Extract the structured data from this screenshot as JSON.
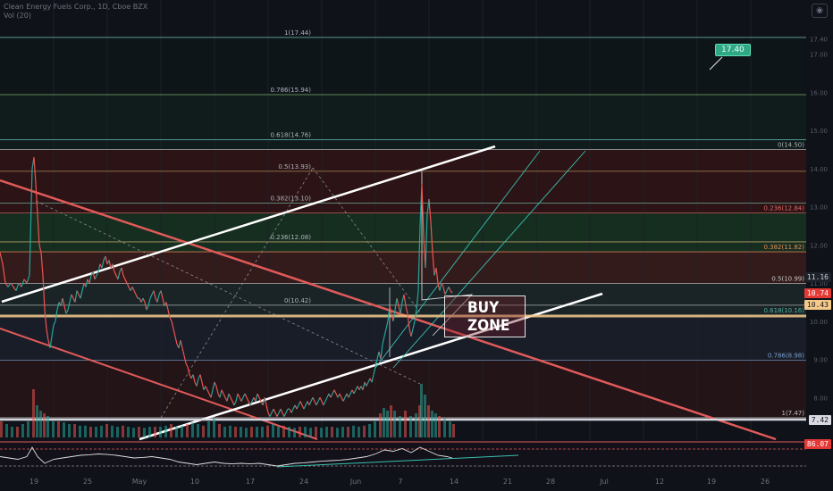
{
  "header": {
    "line1": "Clean Energy Fuels Corp., 1D, Cboe BZX",
    "line2": "Vol (20)"
  },
  "camera_icon": "camera-icon",
  "chart_data": {
    "type": "line",
    "title": "",
    "x_ticks": [
      "19",
      "25",
      "May",
      "10",
      "17",
      "24",
      "Jun",
      "7",
      "14",
      "21",
      "28",
      "Jul",
      "12",
      "19",
      "26"
    ],
    "y_ticks": [
      "17.40",
      "17.00",
      "16.00",
      "15.00",
      "14.00",
      "13.00",
      "12.00",
      "11.00",
      "10.00",
      "9.00",
      "8.00"
    ],
    "ylim": [
      7.0,
      18.0
    ],
    "price_labels": [
      {
        "text": "11.16",
        "value": 11.16,
        "color": "#c8ccd4",
        "bg": "#1e222b"
      },
      {
        "text": "10.74",
        "value": 10.74,
        "color": "#ffffff",
        "bg": "#e53935"
      },
      {
        "text": "10.43",
        "value": 10.43,
        "color": "#0f1218",
        "bg": "#f5c98a"
      },
      {
        "text": "7.42",
        "value": 7.42,
        "color": "#0f1218",
        "bg": "#d8d8e0"
      },
      {
        "text": "86.07",
        "value": 86.07,
        "color": "#ffffff",
        "bg": "#e53935"
      }
    ],
    "target_label": "17.40",
    "fib_left": [
      {
        "text": "1(17.44)",
        "value": 17.44
      },
      {
        "text": "0.786(15.94)",
        "value": 15.94
      },
      {
        "text": "0.618(14.76)",
        "value": 14.76
      },
      {
        "text": "0.5(13.93)",
        "value": 13.93
      },
      {
        "text": "0.382(13.10)",
        "value": 13.1
      },
      {
        "text": "0.236(12.08)",
        "value": 12.08
      },
      {
        "text": "0(10.42)",
        "value": 10.42
      }
    ],
    "fib_right": [
      {
        "text": "0(14.50)",
        "value": 14.5
      },
      {
        "text": "0.236(12.84)",
        "value": 12.84
      },
      {
        "text": "0.382(11.82)",
        "value": 11.82
      },
      {
        "text": "0.5(10.99)",
        "value": 10.99
      },
      {
        "text": "0.618(10.16)",
        "value": 10.16
      },
      {
        "text": "0.786(8.98)",
        "value": 8.98
      },
      {
        "text": "1(7.47)",
        "value": 7.47
      }
    ],
    "price_series": [
      [
        0,
        11.8
      ],
      [
        3,
        11.5
      ],
      [
        6,
        11.0
      ],
      [
        9,
        10.9
      ],
      [
        12,
        11.0
      ],
      [
        15,
        10.9
      ],
      [
        18,
        10.8
      ],
      [
        21,
        11.0
      ],
      [
        24,
        10.9
      ],
      [
        27,
        11.1
      ],
      [
        30,
        11.0
      ],
      [
        33,
        11.2
      ],
      [
        36,
        14.0
      ],
      [
        38,
        14.3
      ],
      [
        40,
        13.6
      ],
      [
        42,
        12.8
      ],
      [
        44,
        12.0
      ],
      [
        46,
        11.8
      ],
      [
        48,
        11.2
      ],
      [
        50,
        10.3
      ],
      [
        52,
        9.8
      ],
      [
        54,
        9.5
      ],
      [
        56,
        9.3
      ],
      [
        58,
        9.6
      ],
      [
        60,
        9.9
      ],
      [
        62,
        10.0
      ],
      [
        64,
        10.3
      ],
      [
        66,
        10.5
      ],
      [
        68,
        10.4
      ],
      [
        70,
        10.6
      ],
      [
        72,
        10.4
      ],
      [
        74,
        10.2
      ],
      [
        76,
        10.3
      ],
      [
        78,
        10.5
      ],
      [
        80,
        10.7
      ],
      [
        82,
        10.6
      ],
      [
        84,
        10.5
      ],
      [
        86,
        10.8
      ],
      [
        88,
        10.7
      ],
      [
        90,
        10.6
      ],
      [
        92,
        10.8
      ],
      [
        94,
        11.0
      ],
      [
        96,
        10.9
      ],
      [
        98,
        11.1
      ],
      [
        100,
        11.0
      ],
      [
        102,
        11.2
      ],
      [
        104,
        11.3
      ],
      [
        106,
        11.1
      ],
      [
        108,
        11.2
      ],
      [
        110,
        11.3
      ],
      [
        112,
        11.5
      ],
      [
        114,
        11.4
      ],
      [
        116,
        11.6
      ],
      [
        118,
        11.7
      ],
      [
        120,
        11.5
      ],
      [
        122,
        11.6
      ],
      [
        124,
        11.4
      ],
      [
        126,
        11.5
      ],
      [
        128,
        11.3
      ],
      [
        130,
        11.2
      ],
      [
        132,
        11.1
      ],
      [
        134,
        11.3
      ],
      [
        136,
        11.4
      ],
      [
        138,
        11.2
      ],
      [
        140,
        11.1
      ],
      [
        142,
        11.0
      ],
      [
        144,
        10.9
      ],
      [
        146,
        10.8
      ],
      [
        148,
        10.9
      ],
      [
        150,
        10.8
      ],
      [
        152,
        10.7
      ],
      [
        154,
        10.6
      ],
      [
        156,
        10.6
      ],
      [
        158,
        10.5
      ],
      [
        160,
        10.6
      ],
      [
        162,
        10.5
      ],
      [
        164,
        10.3
      ],
      [
        166,
        10.4
      ],
      [
        168,
        10.6
      ],
      [
        170,
        10.7
      ],
      [
        172,
        10.8
      ],
      [
        174,
        10.6
      ],
      [
        176,
        10.5
      ],
      [
        178,
        10.7
      ],
      [
        180,
        10.8
      ],
      [
        182,
        10.6
      ],
      [
        184,
        10.4
      ],
      [
        186,
        10.5
      ],
      [
        188,
        10.3
      ],
      [
        190,
        10.1
      ],
      [
        192,
        10.0
      ],
      [
        194,
        9.8
      ],
      [
        196,
        9.6
      ],
      [
        198,
        9.4
      ],
      [
        200,
        9.3
      ],
      [
        202,
        9.5
      ],
      [
        204,
        9.3
      ],
      [
        206,
        9.1
      ],
      [
        208,
        8.9
      ],
      [
        210,
        8.8
      ],
      [
        212,
        8.6
      ],
      [
        214,
        8.5
      ],
      [
        216,
        8.6
      ],
      [
        218,
        8.4
      ],
      [
        220,
        8.3
      ],
      [
        222,
        8.5
      ],
      [
        224,
        8.6
      ],
      [
        226,
        8.4
      ],
      [
        228,
        8.2
      ],
      [
        230,
        8.3
      ],
      [
        232,
        8.2
      ],
      [
        234,
        8.1
      ],
      [
        236,
        8.0
      ],
      [
        238,
        8.2
      ],
      [
        240,
        8.4
      ],
      [
        242,
        8.3
      ],
      [
        244,
        8.1
      ],
      [
        246,
        8.0
      ],
      [
        248,
        8.2
      ],
      [
        250,
        8.1
      ],
      [
        252,
        8.0
      ],
      [
        254,
        7.9
      ],
      [
        256,
        8.1
      ],
      [
        258,
        8.0
      ],
      [
        260,
        7.9
      ],
      [
        262,
        7.8
      ],
      [
        264,
        7.9
      ],
      [
        266,
        8.1
      ],
      [
        268,
        8.0
      ],
      [
        270,
        7.9
      ],
      [
        272,
        8.0
      ],
      [
        274,
        8.1
      ],
      [
        276,
        8.0
      ],
      [
        278,
        7.9
      ],
      [
        280,
        7.8
      ],
      [
        282,
        7.9
      ],
      [
        284,
        8.0
      ],
      [
        286,
        7.9
      ],
      [
        288,
        8.1
      ],
      [
        290,
        8.0
      ],
      [
        292,
        7.9
      ],
      [
        294,
        7.8
      ],
      [
        296,
        8.0
      ],
      [
        298,
        7.8
      ],
      [
        300,
        7.6
      ],
      [
        302,
        7.5
      ],
      [
        304,
        7.6
      ],
      [
        306,
        7.7
      ],
      [
        308,
        7.6
      ],
      [
        310,
        7.5
      ],
      [
        312,
        7.6
      ],
      [
        314,
        7.7
      ],
      [
        316,
        7.6
      ],
      [
        318,
        7.5
      ],
      [
        320,
        7.6
      ],
      [
        322,
        7.7
      ],
      [
        324,
        7.7
      ],
      [
        326,
        7.6
      ],
      [
        328,
        7.7
      ],
      [
        330,
        7.8
      ],
      [
        332,
        7.7
      ],
      [
        334,
        7.8
      ],
      [
        336,
        7.9
      ],
      [
        338,
        7.8
      ],
      [
        340,
        7.7
      ],
      [
        342,
        7.8
      ],
      [
        344,
        7.9
      ],
      [
        346,
        7.8
      ],
      [
        348,
        7.9
      ],
      [
        350,
        8.0
      ],
      [
        352,
        7.9
      ],
      [
        354,
        7.8
      ],
      [
        356,
        7.9
      ],
      [
        358,
        8.0
      ],
      [
        360,
        7.9
      ],
      [
        362,
        7.8
      ],
      [
        364,
        7.9
      ],
      [
        366,
        8.0
      ],
      [
        368,
        8.1
      ],
      [
        370,
        8.0
      ],
      [
        372,
        8.1
      ],
      [
        374,
        8.2
      ],
      [
        376,
        8.1
      ],
      [
        378,
        8.0
      ],
      [
        380,
        8.1
      ],
      [
        382,
        8.0
      ],
      [
        384,
        7.9
      ],
      [
        386,
        8.0
      ],
      [
        388,
        8.1
      ],
      [
        390,
        8.0
      ],
      [
        392,
        8.1
      ],
      [
        394,
        8.2
      ],
      [
        396,
        8.1
      ],
      [
        398,
        8.2
      ],
      [
        400,
        8.3
      ],
      [
        402,
        8.2
      ],
      [
        404,
        8.3
      ],
      [
        406,
        8.2
      ],
      [
        408,
        8.4
      ],
      [
        410,
        8.3
      ],
      [
        412,
        8.4
      ],
      [
        414,
        8.5
      ],
      [
        416,
        8.4
      ],
      [
        418,
        8.6
      ],
      [
        420,
        8.8
      ],
      [
        422,
        9.0
      ],
      [
        424,
        9.2
      ],
      [
        426,
        9.0
      ],
      [
        428,
        9.4
      ],
      [
        430,
        9.6
      ],
      [
        432,
        9.8
      ],
      [
        434,
        10.0
      ],
      [
        436,
        10.4
      ],
      [
        438,
        10.2
      ],
      [
        440,
        10.0
      ],
      [
        442,
        10.3
      ],
      [
        444,
        10.6
      ],
      [
        446,
        10.4
      ],
      [
        448,
        10.2
      ],
      [
        450,
        10.5
      ],
      [
        452,
        10.7
      ],
      [
        454,
        10.4
      ],
      [
        456,
        10.2
      ],
      [
        458,
        9.8
      ],
      [
        460,
        9.6
      ],
      [
        462,
        9.8
      ],
      [
        464,
        10.0
      ],
      [
        466,
        10.3
      ],
      [
        468,
        10.8
      ],
      [
        470,
        12.5
      ],
      [
        472,
        13.6
      ],
      [
        474,
        12.2
      ],
      [
        476,
        11.4
      ],
      [
        478,
        12.8
      ],
      [
        480,
        13.2
      ],
      [
        482,
        12.6
      ],
      [
        484,
        11.8
      ],
      [
        486,
        11.2
      ],
      [
        488,
        11.4
      ],
      [
        490,
        11.0
      ],
      [
        492,
        10.8
      ],
      [
        494,
        11.0
      ],
      [
        496,
        10.9
      ],
      [
        498,
        10.7
      ],
      [
        500,
        10.8
      ],
      [
        502,
        10.9
      ],
      [
        504,
        10.8
      ],
      [
        506,
        10.74
      ]
    ],
    "volume_series": [
      [
        0,
        0.3
      ],
      [
        6,
        0.25
      ],
      [
        12,
        0.2
      ],
      [
        18,
        0.2
      ],
      [
        24,
        0.25
      ],
      [
        30,
        0.3
      ],
      [
        36,
        0.9
      ],
      [
        40,
        0.6
      ],
      [
        44,
        0.5
      ],
      [
        48,
        0.45
      ],
      [
        52,
        0.4
      ],
      [
        58,
        0.3
      ],
      [
        64,
        0.3
      ],
      [
        70,
        0.28
      ],
      [
        76,
        0.25
      ],
      [
        82,
        0.25
      ],
      [
        88,
        0.22
      ],
      [
        94,
        0.22
      ],
      [
        100,
        0.2
      ],
      [
        106,
        0.2
      ],
      [
        112,
        0.22
      ],
      [
        118,
        0.25
      ],
      [
        124,
        0.22
      ],
      [
        130,
        0.2
      ],
      [
        136,
        0.22
      ],
      [
        142,
        0.2
      ],
      [
        148,
        0.18
      ],
      [
        154,
        0.2
      ],
      [
        160,
        0.18
      ],
      [
        166,
        0.2
      ],
      [
        172,
        0.2
      ],
      [
        178,
        0.2
      ],
      [
        184,
        0.22
      ],
      [
        190,
        0.25
      ],
      [
        196,
        0.2
      ],
      [
        202,
        0.22
      ],
      [
        208,
        0.25
      ],
      [
        214,
        0.28
      ],
      [
        220,
        0.25
      ],
      [
        226,
        0.22
      ],
      [
        232,
        0.3
      ],
      [
        238,
        0.35
      ],
      [
        244,
        0.25
      ],
      [
        250,
        0.2
      ],
      [
        256,
        0.22
      ],
      [
        262,
        0.2
      ],
      [
        268,
        0.2
      ],
      [
        274,
        0.18
      ],
      [
        280,
        0.2
      ],
      [
        286,
        0.2
      ],
      [
        292,
        0.2
      ],
      [
        298,
        0.22
      ],
      [
        304,
        0.25
      ],
      [
        310,
        0.2
      ],
      [
        316,
        0.22
      ],
      [
        322,
        0.2
      ],
      [
        328,
        0.18
      ],
      [
        334,
        0.2
      ],
      [
        340,
        0.2
      ],
      [
        346,
        0.18
      ],
      [
        352,
        0.2
      ],
      [
        358,
        0.18
      ],
      [
        364,
        0.2
      ],
      [
        370,
        0.2
      ],
      [
        376,
        0.18
      ],
      [
        382,
        0.2
      ],
      [
        388,
        0.2
      ],
      [
        394,
        0.22
      ],
      [
        400,
        0.2
      ],
      [
        406,
        0.22
      ],
      [
        412,
        0.25
      ],
      [
        418,
        0.3
      ],
      [
        424,
        0.45
      ],
      [
        428,
        0.55
      ],
      [
        432,
        0.5
      ],
      [
        436,
        0.6
      ],
      [
        440,
        0.5
      ],
      [
        446,
        0.4
      ],
      [
        452,
        0.5
      ],
      [
        458,
        0.4
      ],
      [
        464,
        0.45
      ],
      [
        468,
        0.6
      ],
      [
        470,
        1.0
      ],
      [
        474,
        0.8
      ],
      [
        478,
        0.6
      ],
      [
        482,
        0.5
      ],
      [
        486,
        0.45
      ],
      [
        490,
        0.4
      ],
      [
        496,
        0.35
      ],
      [
        502,
        0.3
      ],
      [
        506,
        0.25
      ]
    ],
    "indicator_series": [
      [
        0,
        0.55
      ],
      [
        10,
        0.5
      ],
      [
        20,
        0.45
      ],
      [
        30,
        0.55
      ],
      [
        36,
        0.9
      ],
      [
        42,
        0.55
      ],
      [
        50,
        0.3
      ],
      [
        60,
        0.45
      ],
      [
        70,
        0.5
      ],
      [
        80,
        0.55
      ],
      [
        90,
        0.6
      ],
      [
        100,
        0.62
      ],
      [
        110,
        0.65
      ],
      [
        120,
        0.63
      ],
      [
        130,
        0.6
      ],
      [
        140,
        0.55
      ],
      [
        150,
        0.5
      ],
      [
        160,
        0.52
      ],
      [
        170,
        0.55
      ],
      [
        180,
        0.5
      ],
      [
        190,
        0.45
      ],
      [
        200,
        0.35
      ],
      [
        210,
        0.3
      ],
      [
        220,
        0.25
      ],
      [
        230,
        0.3
      ],
      [
        240,
        0.35
      ],
      [
        250,
        0.3
      ],
      [
        260,
        0.28
      ],
      [
        270,
        0.3
      ],
      [
        280,
        0.28
      ],
      [
        290,
        0.3
      ],
      [
        300,
        0.25
      ],
      [
        310,
        0.2
      ],
      [
        320,
        0.25
      ],
      [
        330,
        0.3
      ],
      [
        340,
        0.32
      ],
      [
        350,
        0.35
      ],
      [
        360,
        0.38
      ],
      [
        370,
        0.4
      ],
      [
        380,
        0.42
      ],
      [
        390,
        0.45
      ],
      [
        400,
        0.5
      ],
      [
        410,
        0.55
      ],
      [
        420,
        0.65
      ],
      [
        430,
        0.8
      ],
      [
        440,
        0.75
      ],
      [
        450,
        0.85
      ],
      [
        460,
        0.7
      ],
      [
        470,
        0.9
      ],
      [
        480,
        0.75
      ],
      [
        490,
        0.6
      ],
      [
        500,
        0.55
      ],
      [
        506,
        0.5
      ]
    ]
  },
  "buy_zone": {
    "line1": "BUY",
    "line2": "ZONE"
  }
}
